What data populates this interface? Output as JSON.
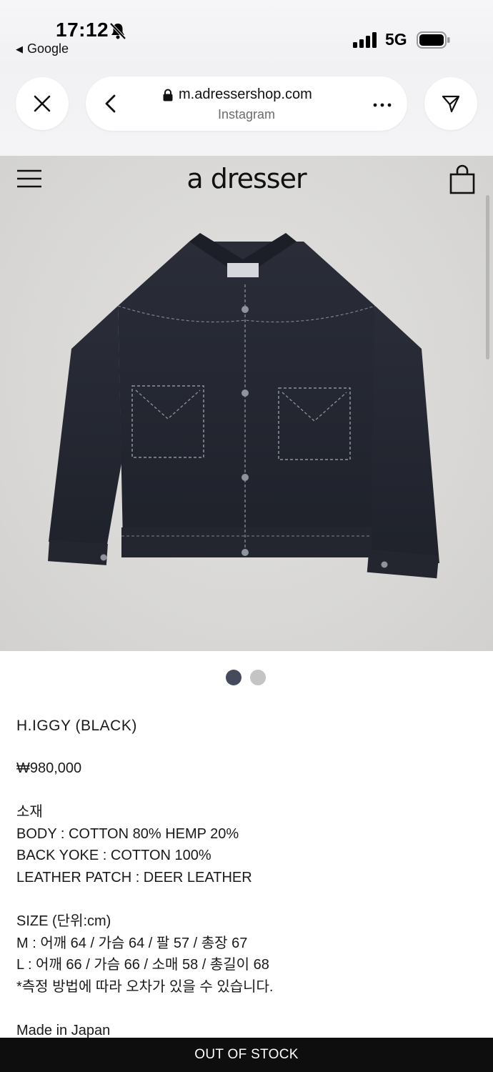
{
  "status_bar": {
    "time": "17:12",
    "back_app": "Google",
    "network": "5G",
    "icons": [
      "bell-off-icon",
      "signal-icon",
      "battery-icon"
    ]
  },
  "browser": {
    "url": "m.adressershop.com",
    "subtitle": "Instagram",
    "icons": [
      "close-icon",
      "chevron-left-icon",
      "lock-icon",
      "more-icon",
      "share-icon"
    ]
  },
  "site": {
    "brand": "a dresser",
    "icons": [
      "menu-icon",
      "shopping-bag-icon"
    ]
  },
  "gallery": {
    "total_images": 2,
    "active_index": 0,
    "colors": {
      "active": "#454b5c",
      "inactive": "#c4c4c4"
    }
  },
  "product": {
    "name": "H.IGGY (BLACK)",
    "price": "₩980,000",
    "material_heading": "소재",
    "materials": [
      "BODY : COTTON 80% HEMP 20%",
      "BACK YOKE : COTTON 100%",
      "LEATHER PATCH : DEER LEATHER"
    ],
    "size_heading": "SIZE (단위:cm)",
    "sizes": [
      "M : 어깨 64 / 가슴 64 / 팔 57 / 총장 67",
      "L : 어깨 66 / 가슴 66 / 소매 58 / 총길이 68"
    ],
    "size_note": "*측정 방법에 따라 오차가 있을 수 있습니다.",
    "origin_partial": "Made in Japan"
  },
  "bottom_button": {
    "label": "OUT OF STOCK",
    "colors": {
      "background": "#0e0e0e",
      "text": "#ffffff"
    }
  }
}
